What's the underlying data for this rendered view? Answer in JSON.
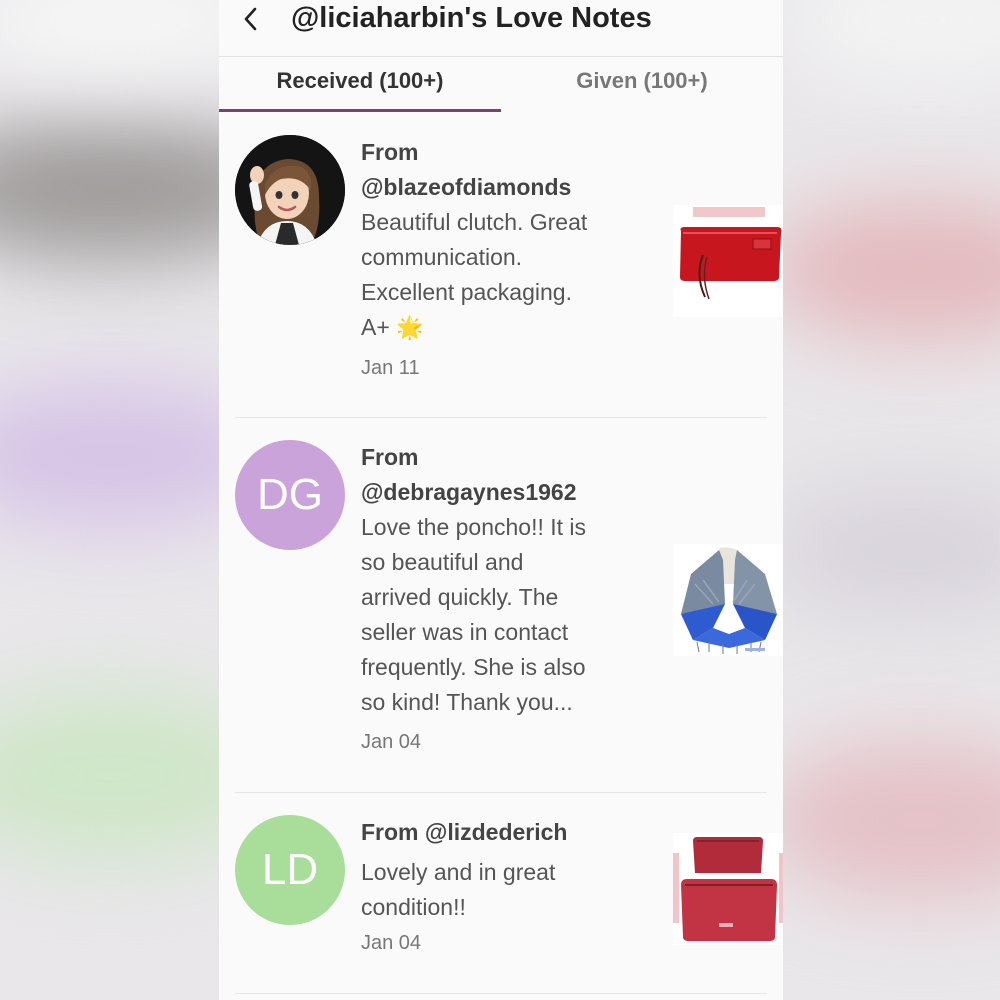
{
  "header": {
    "title": "@liciaharbin's Love Notes"
  },
  "tabs": [
    {
      "label": "Received (100+)",
      "active": true
    },
    {
      "label": "Given (100+)",
      "active": false
    }
  ],
  "notes": [
    {
      "from": "From @blazeofdiamonds",
      "from_line1": "From",
      "from_line2": "@blazeofdiamonds",
      "message": "Beautiful clutch. Great communication. Excellent packaging. A+",
      "message_lines": [
        "Beautiful clutch. Great",
        "communication.",
        "Excellent packaging.",
        "A+"
      ],
      "emoji": "🌟",
      "date": "Jan 11",
      "avatar_type": "photo",
      "item_image": "red-clutch"
    },
    {
      "from": "From @debragaynes1962",
      "from_line1": "From",
      "from_line2": "@debragaynes1962",
      "message": "Love the poncho!! It is so beautiful and arrived quickly. The seller was in contact frequently. She is also so kind! Thank you...",
      "message_lines": [
        "Love the poncho!! It is",
        "so beautiful and",
        "arrived quickly. The",
        "seller was in contact",
        "frequently. She is also",
        "so kind! Thank you..."
      ],
      "date": "Jan 04",
      "avatar_initials": "DG",
      "avatar_color": "#caa3db",
      "item_image": "poncho"
    },
    {
      "from": "From @lizdederich",
      "message": "Lovely and in great condition!!",
      "message_lines": [
        "Lovely and in great",
        "condition!!"
      ],
      "date": "Jan 04",
      "avatar_initials": "LD",
      "avatar_color": "#a9dd9a",
      "item_image": "pouch-set"
    }
  ],
  "colors": {
    "tab_underline": "#7d3f73",
    "text_primary": "#222222",
    "text_secondary": "#777777"
  }
}
